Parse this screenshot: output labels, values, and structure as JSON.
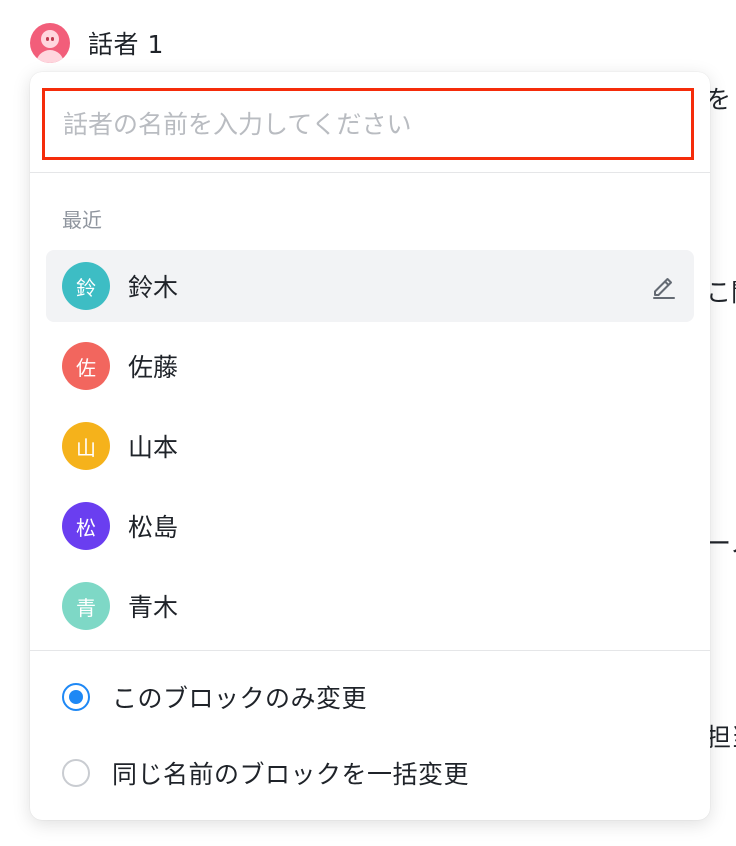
{
  "speaker": {
    "name": "話者 1",
    "avatar_color": "#f25e7a",
    "avatar_icon": "person-avatar-icon"
  },
  "background_text": [
    "を",
    "こ関",
    "ーノ",
    "担当"
  ],
  "popup": {
    "input": {
      "value": "",
      "placeholder": "話者の名前を入力してください",
      "highlight_color": "#f52c0a"
    },
    "recent_label": "最近",
    "recent": [
      {
        "initial": "鈴",
        "name": "鈴木",
        "color": "#3dbdc4",
        "hovered": true
      },
      {
        "initial": "佐",
        "name": "佐藤",
        "color": "#f2665e",
        "hovered": false
      },
      {
        "initial": "山",
        "name": "山本",
        "color": "#f5b21b",
        "hovered": false
      },
      {
        "initial": "松",
        "name": "松島",
        "color": "#6a3ef0",
        "hovered": false
      },
      {
        "initial": "青",
        "name": "青木",
        "color": "#7ed8c6",
        "hovered": false
      }
    ],
    "edit_icon": "pencil-icon",
    "options": [
      {
        "label": "このブロックのみ変更",
        "checked": true
      },
      {
        "label": "同じ名前のブロックを一括変更",
        "checked": false
      }
    ],
    "accent_color": "#1e88f5"
  }
}
